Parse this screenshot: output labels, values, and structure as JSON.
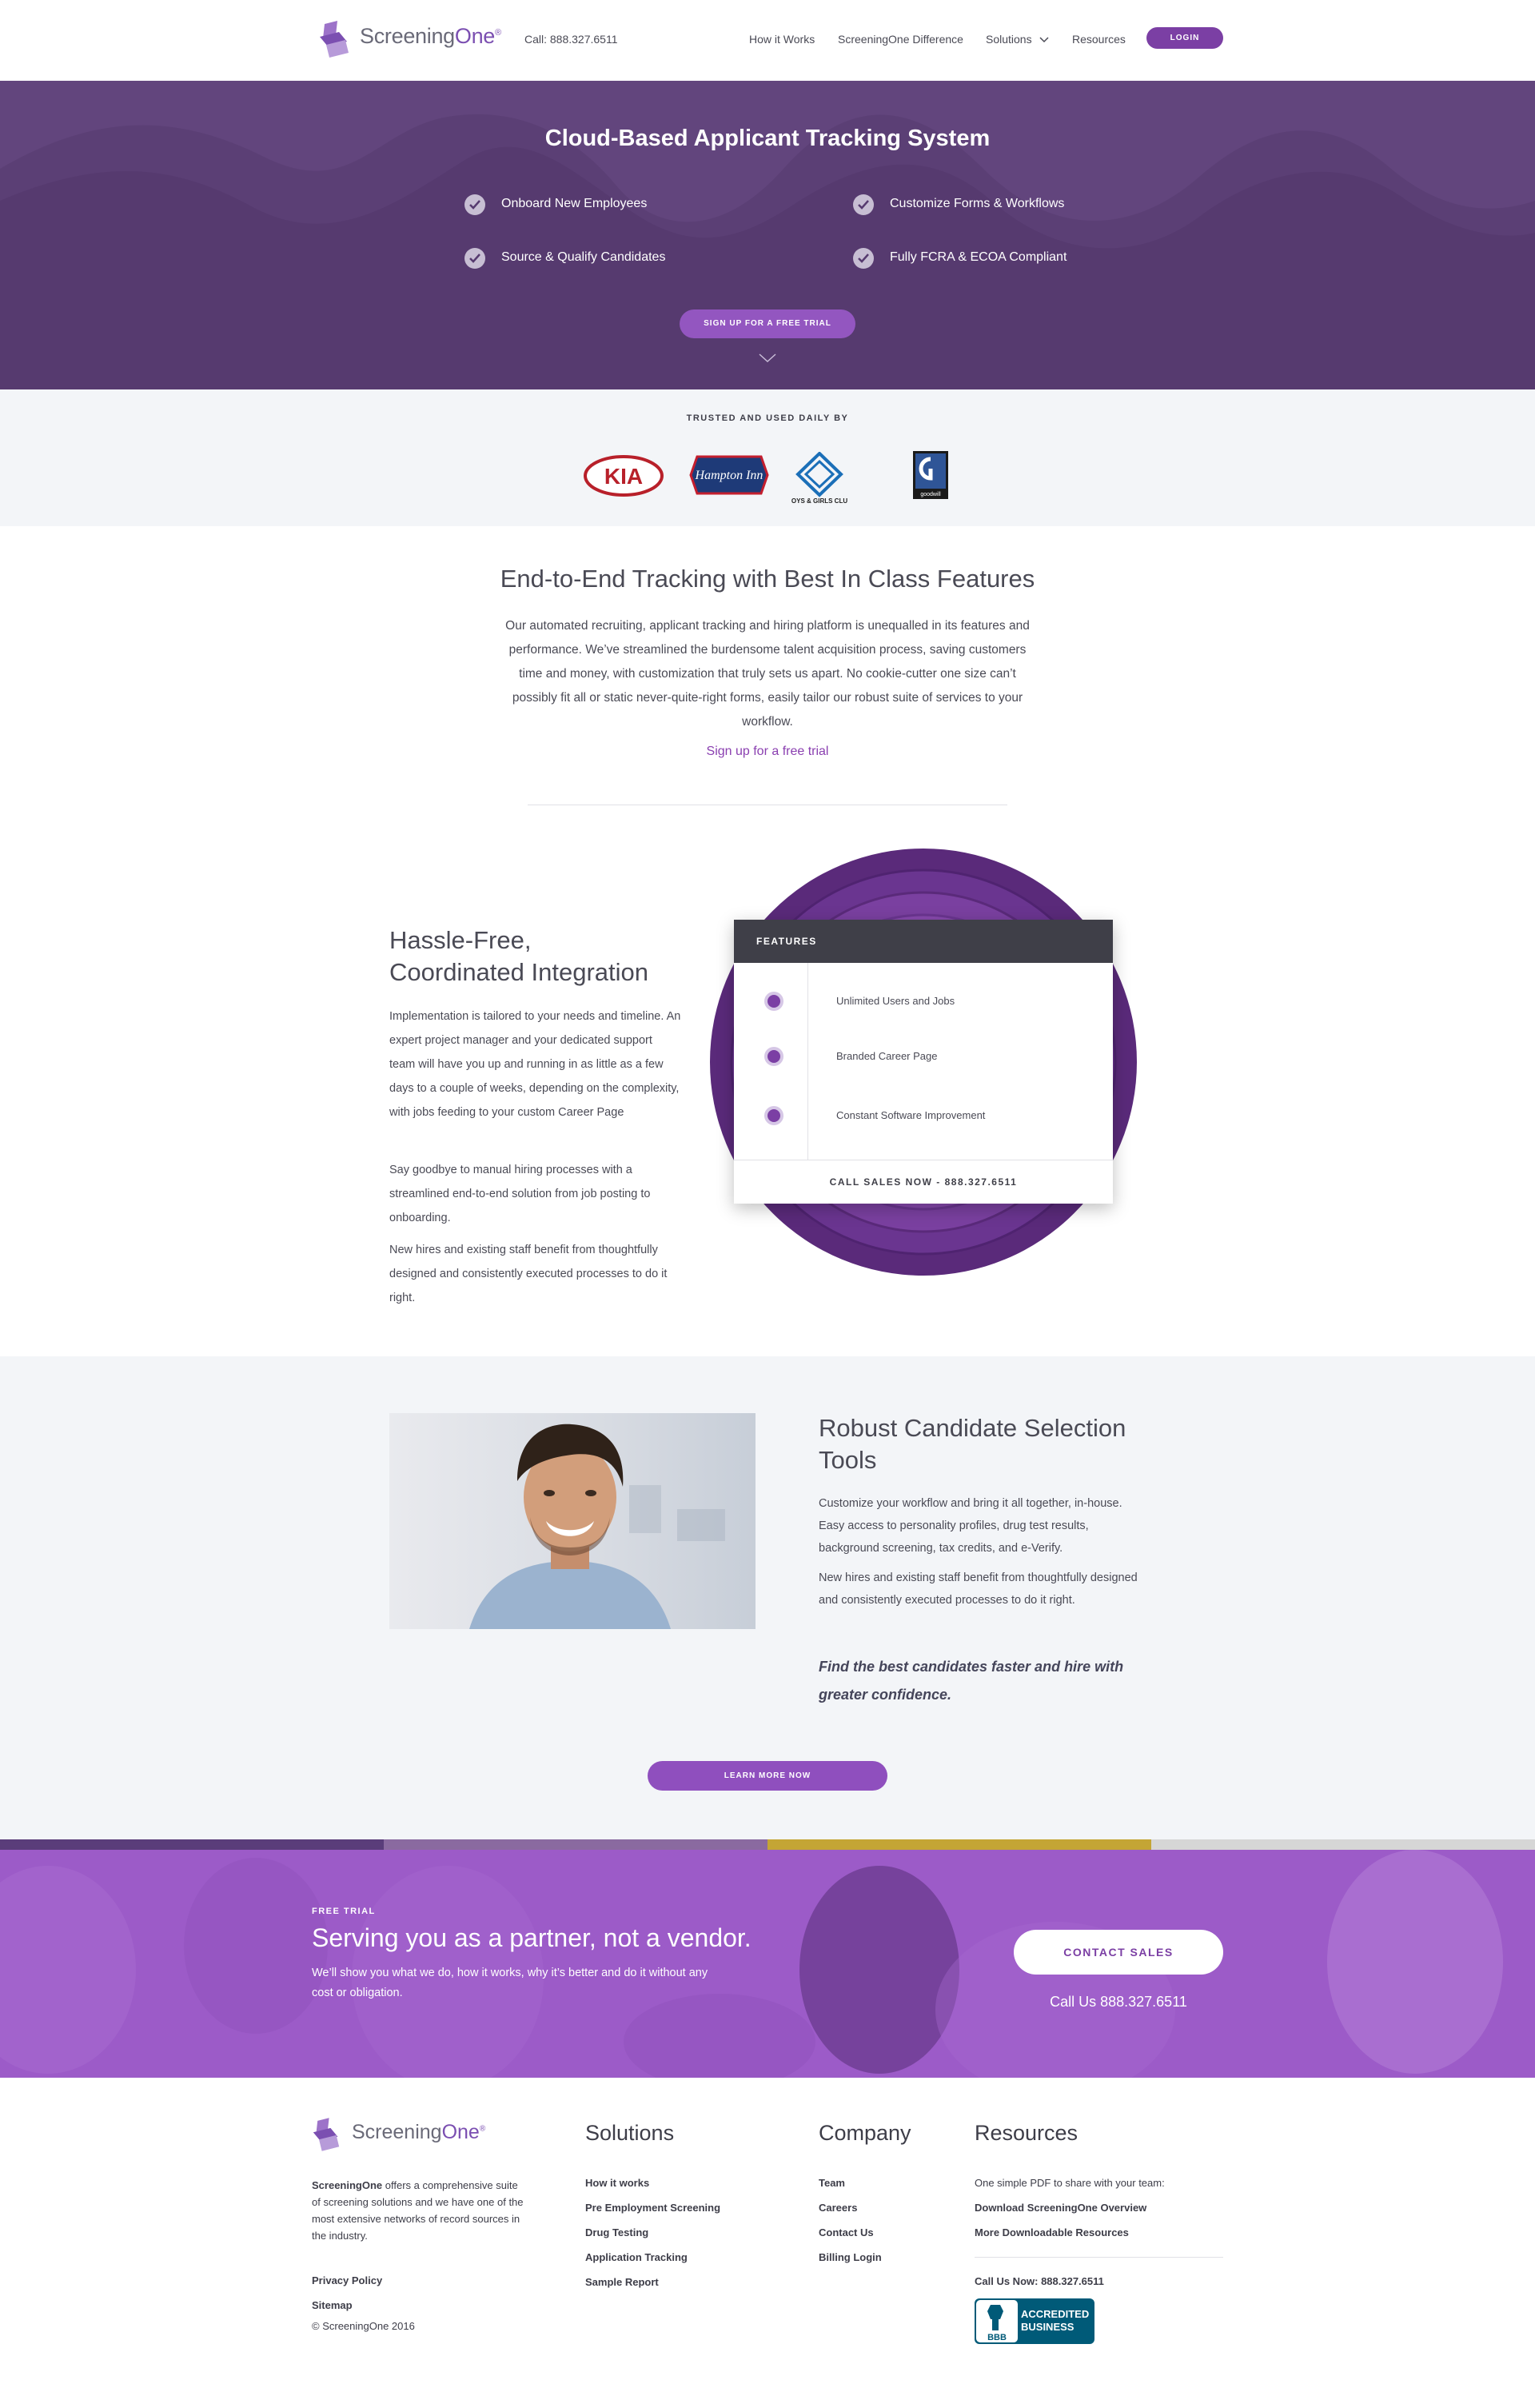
{
  "header": {
    "logo": {
      "text_plain": "Screening",
      "text_brand": "One",
      "registered": "®"
    },
    "call": "Call: 888.327.6511",
    "nav": [
      {
        "label": "How it Works"
      },
      {
        "label": "ScreeningOne Difference"
      },
      {
        "label": "Solutions"
      },
      {
        "label": "Resources"
      }
    ],
    "login": "LOGIN"
  },
  "hero": {
    "title": "Cloud-Based Applicant Tracking System",
    "features": [
      "Onboard New Employees",
      "Customize Forms & Workflows",
      "Source & Qualify Candidates",
      "Fully FCRA & ECOA Compliant"
    ],
    "cta": "SIGN UP FOR A FREE TRIAL",
    "colors": {
      "background": "#563a6f",
      "button": "#9356c0"
    }
  },
  "trusted": {
    "label": "TRUSTED AND USED DAILY BY",
    "logos": [
      {
        "name": "kia-logo",
        "text": "KIA"
      },
      {
        "name": "hampton-inn-logo",
        "text": "Hampton Inn"
      },
      {
        "name": "boys-girls-club-logo",
        "text": "BOYS & GIRLS CLUB"
      },
      {
        "name": "goodwill-logo",
        "text": "goodwill"
      }
    ]
  },
  "intro": {
    "title": "End-to-End Tracking with Best In Class Features",
    "body": "Our automated recruiting, applicant tracking and hiring platform is unequalled in its features and performance. We’ve streamlined the burdensome talent acquisition process, saving customers time and money, with customization that truly sets us apart. No cookie-cutter one size can’t possibly fit all or static never-quite-right forms, easily tailor our robust suite of services to your workflow.",
    "link": "Sign up for a free trial"
  },
  "integration": {
    "title_line1": "Hassle-Free,",
    "title_line2": "Coordinated Integration",
    "paragraphs": [
      "Implementation is tailored to your needs and timeline. An expert project manager and your dedicated support team will have you up and running in as little as a few days to a couple of weeks, depending on the complexity, with jobs feeding to your custom Career Page",
      "Say goodbye to manual hiring processes with a streamlined end-to-end solution from job posting to onboarding.",
      "New hires and existing staff benefit from thoughtfully designed and consistently executed processes to do it right."
    ],
    "card": {
      "heading": "FEATURES",
      "items": [
        "Unlimited Users and Jobs",
        "Branded Career Page",
        "Constant Software Improvement"
      ],
      "footer": "CALL SALES NOW  -  888.327.6511"
    }
  },
  "robust": {
    "title_line1": "Robust Candidate Selection",
    "title_line2": "Tools",
    "paragraphs": [
      "Customize your workflow and bring it all together, in-house. Easy access to personality profiles, drug test results, background screening, tax credits, and e-Verify.",
      "New hires and existing staff benefit from thoughtfully designed and consistently executed processes to do it right."
    ],
    "emphasis": "Find the best candidates faster and hire with greater confidence.",
    "button": "LEARN MORE NOW"
  },
  "cta": {
    "kicker": "FREE TRIAL",
    "title": "Serving you as a partner, not a vendor.",
    "sub": "We’ll show you what we do, how it works, why it’s better and do it without any cost or obligation.",
    "button": "CONTACT SALES",
    "call": "Call Us 888.327.6511",
    "strip_colors": [
      "#5a3d7a",
      "#8a6aa0",
      "#c4a535",
      "#d6d6d6"
    ]
  },
  "footer": {
    "logo": {
      "text_plain": "Screening",
      "text_brand": "One",
      "registered": "®"
    },
    "about_brand": "ScreeningOne",
    "about": " offers a comprehensive suite of screening solutions and we have one of the most extensive networks of record sources in the industry.",
    "privacy": "Privacy Policy",
    "sitemap": "Sitemap",
    "copyright": "© ScreeningOne 2016",
    "solutions": {
      "title": "Solutions",
      "links": [
        "How it works",
        "Pre Employment Screening",
        "Drug Testing",
        "Application Tracking",
        "Sample Report"
      ]
    },
    "company": {
      "title": "Company",
      "links": [
        "Team",
        "Careers",
        "Contact Us",
        "Billing Login"
      ]
    },
    "resources": {
      "title": "Resources",
      "intro": "One simple PDF to share with your team:",
      "links": [
        "Download ScreeningOne Overview",
        "More Downloadable Resources"
      ],
      "call": "Call Us Now: 888.327.6511",
      "bbb_line1": "ACCREDITED",
      "bbb_line2": "BUSINESS",
      "bbb_mark": "BBB"
    }
  }
}
